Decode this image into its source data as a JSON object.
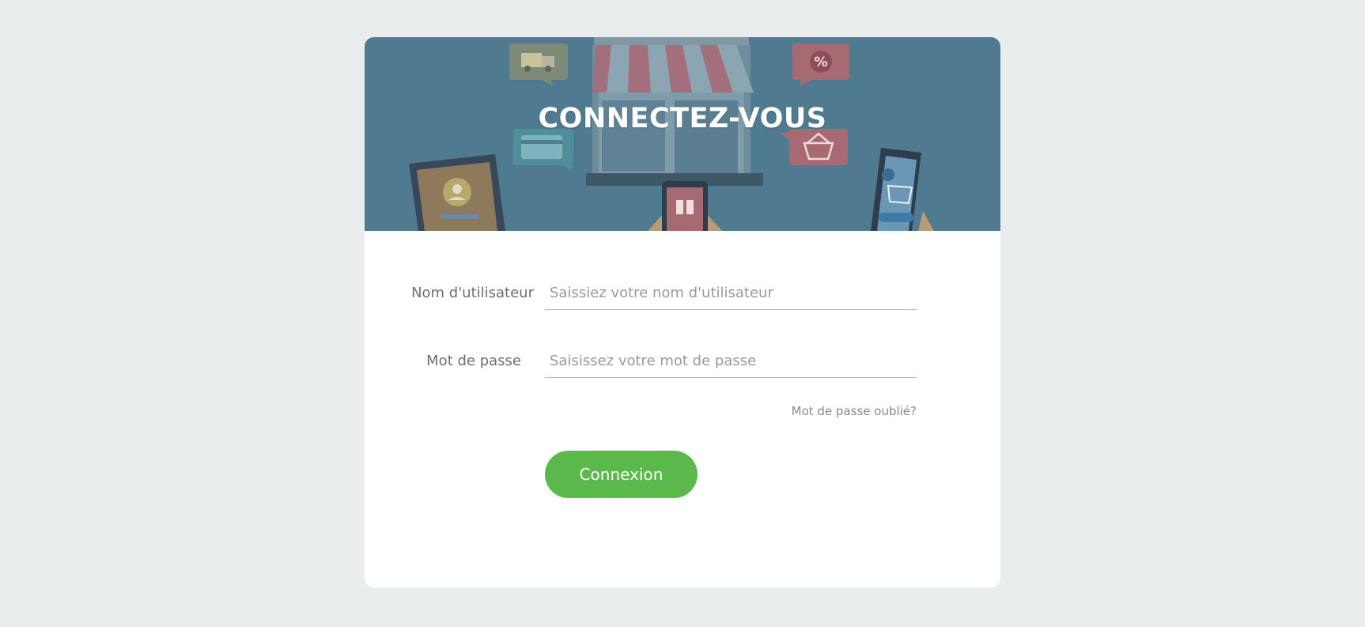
{
  "header": {
    "title": "CONNECTEZ-VOUS"
  },
  "form": {
    "username_label": "Nom d'utilisateur",
    "username_placeholder": "Saissiez votre nom d'utilisateur",
    "username_value": "",
    "password_label": "Mot de passe",
    "password_placeholder": "Saisissez votre mot de passe",
    "password_value": "",
    "forgot_link": "Mot de passe oublié?",
    "submit_label": "Connexion"
  },
  "colors": {
    "page_background": "#e9edee",
    "hero_overlay": "#4f7a8f",
    "button": "#5ab94a",
    "card": "#ffffff"
  },
  "icons": [
    "store-awning-icon",
    "delivery-truck-icon",
    "percent-badge-icon",
    "credit-card-icon",
    "shopping-basket-icon",
    "tablet-profile-icon",
    "phone-gift-icon",
    "phone-cart-icon"
  ]
}
